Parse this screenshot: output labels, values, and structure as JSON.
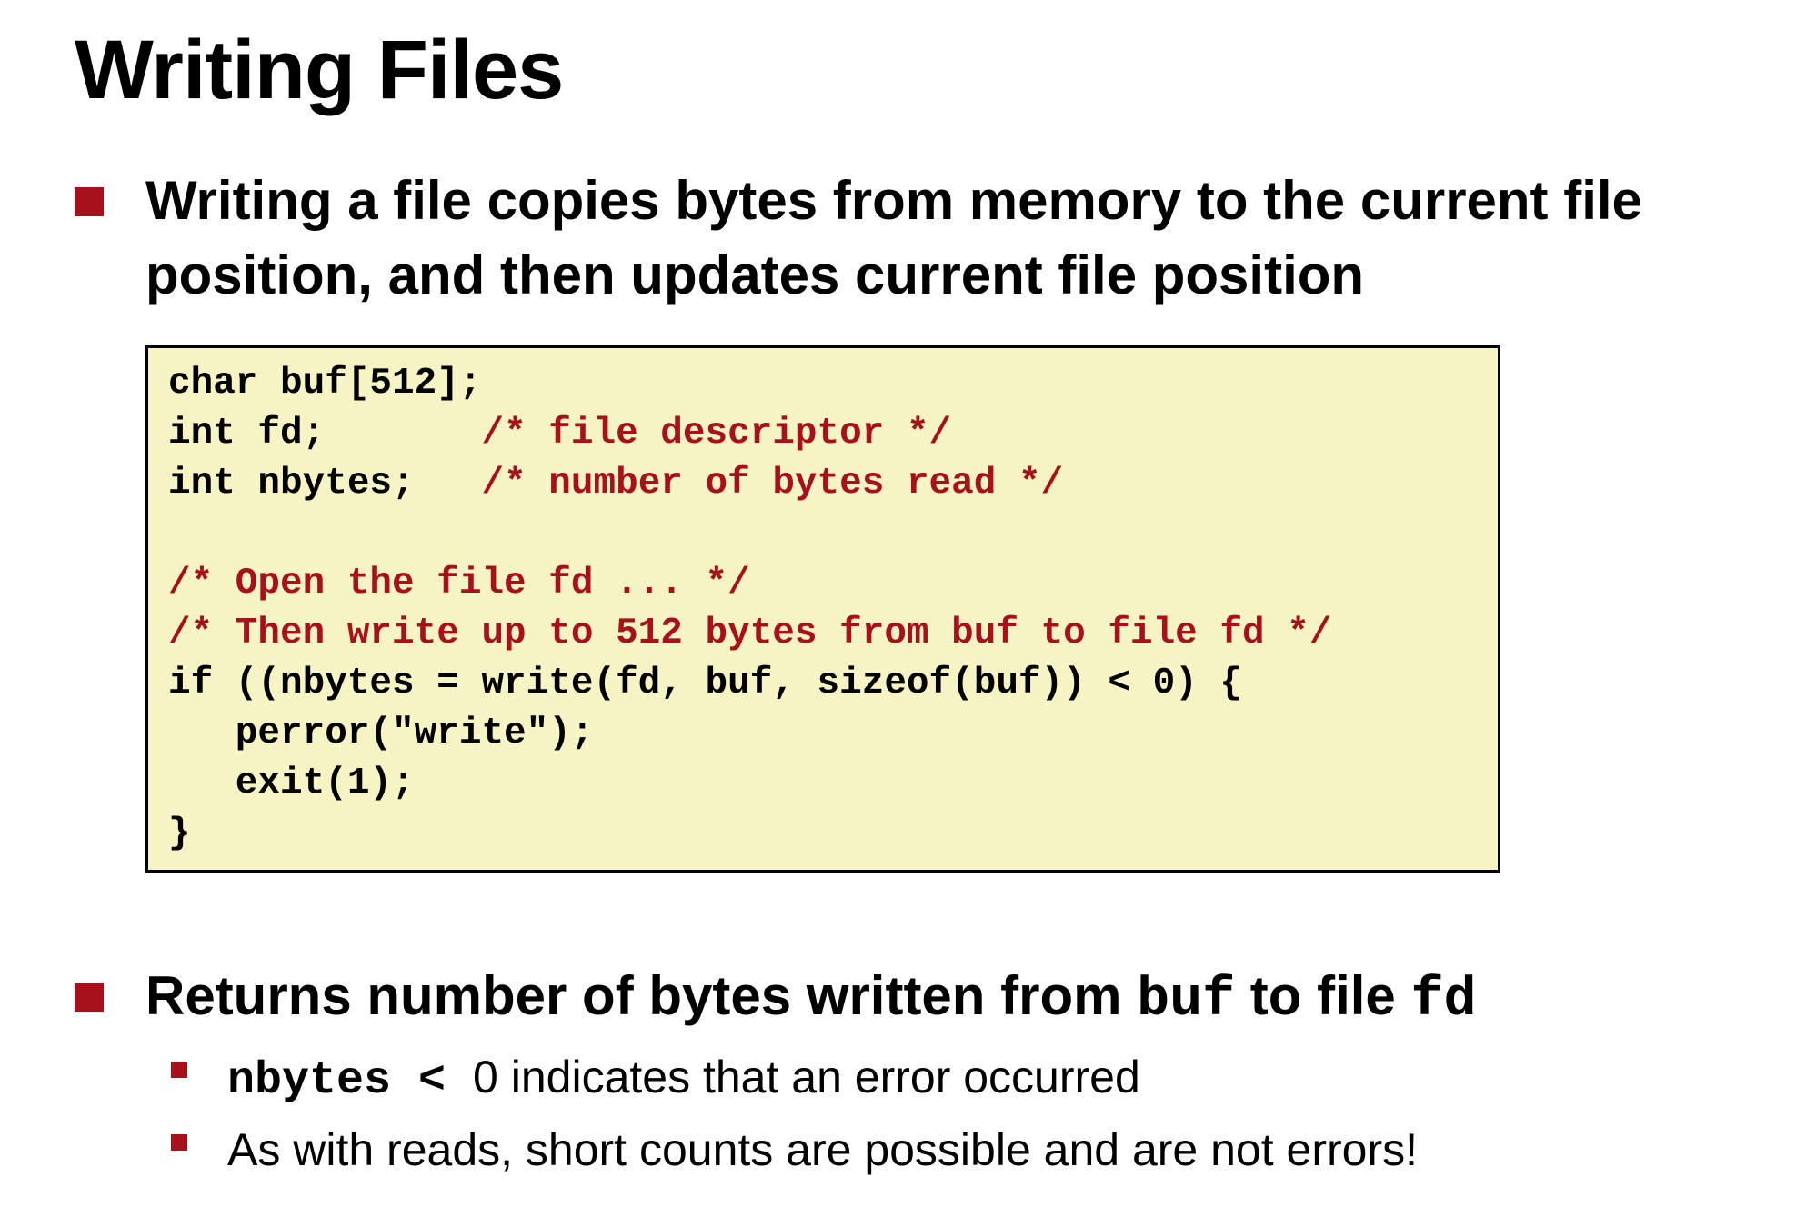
{
  "title": "Writing Files",
  "bullets": [
    {
      "line1": "Writing a file copies bytes from memory to the current file",
      "line2": "position, and then updates current file position"
    },
    {
      "text_a": "Returns number of bytes written from ",
      "code_a": "buf",
      "text_b": " to file ",
      "code_b": "fd"
    }
  ],
  "code": {
    "line1": "char buf[512];",
    "line2_code": "int fd;       ",
    "line2_comment": "/* file descriptor */",
    "line3_code": "int nbytes;   ",
    "line3_comment": "/* number of bytes read */",
    "line4": "",
    "line5": "/* Open the file fd ... */",
    "line6": "/* Then write up to 512 bytes from buf to file fd */",
    "line7": "if ((nbytes = write(fd, buf, sizeof(buf)) < 0) {",
    "line8": "   perror(\"write\");",
    "line9": "   exit(1);",
    "line10": "}"
  },
  "sub_bullets": [
    {
      "code": "nbytes < ",
      "text": "0 indicates that an error occurred"
    },
    {
      "text": "As with reads, short counts are possible and are not errors!"
    }
  ],
  "colors": {
    "accent": "#a5121b",
    "code_background": "#f6f3c4"
  }
}
